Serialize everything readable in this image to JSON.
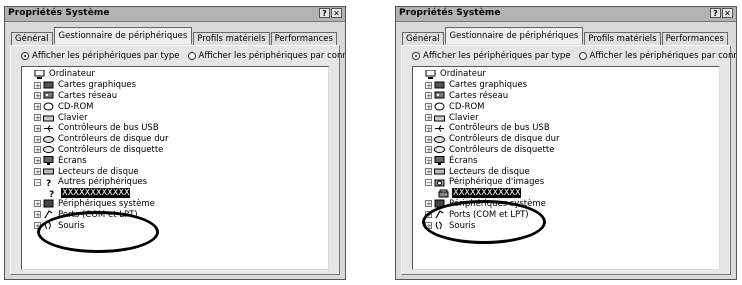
{
  "windows": [
    {
      "title": "Propriétés Système",
      "help_btn": "?",
      "close_btn": "✕",
      "tabs": [
        "Général",
        "Gestionnaire de périphériques",
        "Profils matériels",
        "Performances"
      ],
      "radio_by_type": "Afficher les périphériques par type",
      "radio_by_connection": "Afficher les périphériques par connexion",
      "tree": {
        "root": "Ordinateur",
        "items": [
          "Cartes graphiques",
          "Cartes réseau",
          "CD-ROM",
          "Clavier",
          "Contrôleurs de bus USB",
          "Contrôleurs de disque dur",
          "Contrôleurs de disquette",
          "Écrans",
          "Lecteurs de disque",
          "Autres périphériques"
        ],
        "highlighted_child": "XXXXXXXXXXXX",
        "after_items": [
          "Périphériques système",
          "Ports (COM et LPT)",
          "Souris"
        ]
      }
    },
    {
      "title": "Propriétés Système",
      "help_btn": "?",
      "close_btn": "✕",
      "tabs": [
        "Général",
        "Gestionnaire de périphériques",
        "Profils matériels",
        "Performances"
      ],
      "radio_by_type": "Afficher les périphériques par type",
      "radio_by_connection": "Afficher les périphériques par connexion",
      "tree": {
        "root": "Ordinateur",
        "items": [
          "Cartes graphiques",
          "Cartes réseau",
          "CD-ROM",
          "Clavier",
          "Contrôleurs de bus USB",
          "Contrôleurs de disque dur",
          "Contrôleurs de disquette",
          "Écrans",
          "Lecteurs de disque",
          "Périphérique d'images"
        ],
        "highlighted_child": "XXXXXXXXXXXX",
        "after_items": [
          "Périphériques système",
          "Ports (COM et LPT)",
          "Souris"
        ]
      }
    }
  ]
}
